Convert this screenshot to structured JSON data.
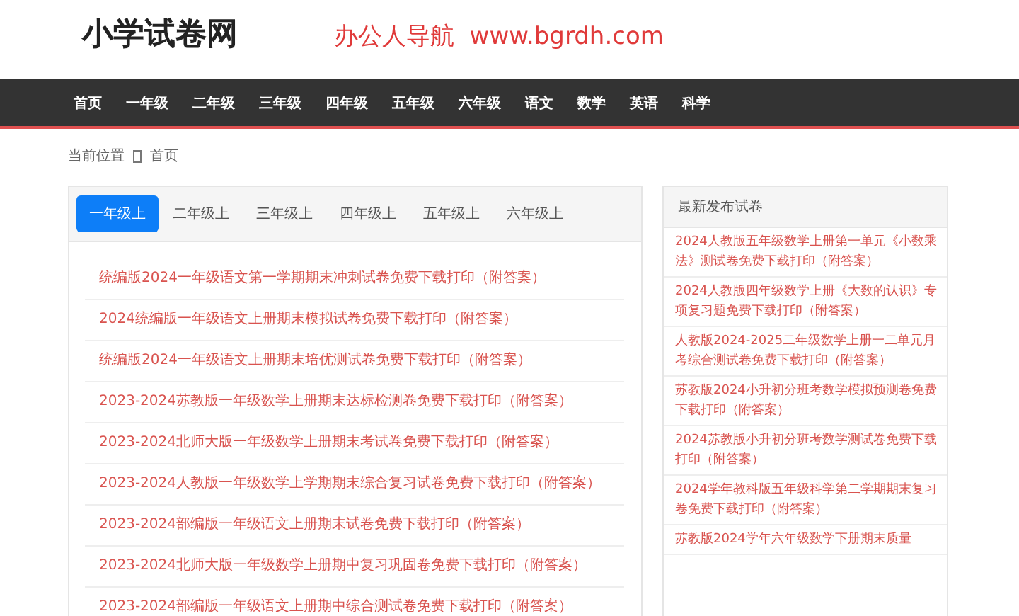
{
  "header": {
    "logo": "小学试卷网",
    "ad_text": "办公人导航  www.bgrdh.com"
  },
  "nav": [
    "首页",
    "一年级",
    "二年级",
    "三年级",
    "四年级",
    "五年级",
    "六年级",
    "语文",
    "数学",
    "英语",
    "科学"
  ],
  "breadcrumb": {
    "label": "当前位置",
    "items": [
      "首页"
    ]
  },
  "tabs": [
    {
      "label": "一年级上",
      "selected": true
    },
    {
      "label": "二年级上",
      "selected": false
    },
    {
      "label": "三年级上",
      "selected": false
    },
    {
      "label": "四年级上",
      "selected": false
    },
    {
      "label": "五年级上",
      "selected": false
    },
    {
      "label": "六年级上",
      "selected": false
    }
  ],
  "articles": [
    "统编版2024一年级语文第一学期期末冲刺试卷免费下载打印（附答案）",
    "2024统编版一年级语文上册期末模拟试卷免费下载打印（附答案）",
    "统编版2024一年级语文上册期末培优测试卷免费下载打印（附答案）",
    "2023-2024苏教版一年级数学上册期末达标检测卷免费下载打印（附答案）",
    "2023-2024北师大版一年级数学上册期末考试卷免费下载打印（附答案）",
    "2023-2024人教版一年级数学上学期期末综合复习试卷免费下载打印（附答案）",
    "2023-2024部编版一年级语文上册期末试卷免费下载打印（附答案）",
    "2023-2024北师大版一年级数学上册期中复习巩固卷免费下载打印（附答案）",
    "2023-2024部编版一年级语文上册期中综合测试卷免费下载打印（附答案）"
  ],
  "sidebar": {
    "title": "最新发布试卷",
    "items": [
      "2024人教版五年级数学上册第一单元《小数乘法》测试卷免费下载打印（附答案）",
      "2024人教版四年级数学上册《大数的认识》专项复习题免费下载打印（附答案）",
      "人教版2024-2025二年级数学上册一二单元月考综合测试卷免费下载打印（附答案）",
      "苏教版2024小升初分班考数学模拟预测卷免费下载打印（附答案）",
      "2024苏教版小升初分班考数学测试卷免费下载打印（附答案）",
      "2024学年教科版五年级科学第二学期期末复习卷免费下载打印（附答案）",
      "苏教版2024学年六年级数学下册期末质量"
    ]
  }
}
